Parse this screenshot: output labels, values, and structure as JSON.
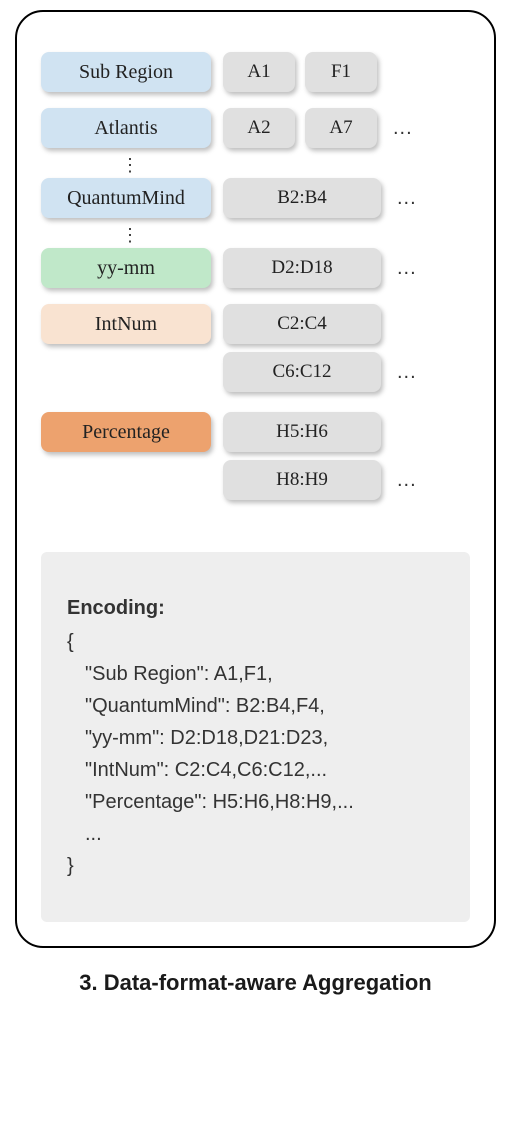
{
  "rows": {
    "sub_region": {
      "label": "Sub Region",
      "cells": [
        "A1",
        "F1"
      ]
    },
    "atlantis": {
      "label": "Atlantis",
      "cells": [
        "A2",
        "A7"
      ],
      "more": "..."
    },
    "quantummind": {
      "label": "QuantumMind",
      "cells": [
        "B2:B4"
      ],
      "more": "..."
    },
    "yymm": {
      "label": "yy-mm",
      "cells": [
        "D2:D18"
      ],
      "more": "..."
    },
    "intnum": {
      "label": "IntNum",
      "cells": [
        "C2:C4"
      ]
    },
    "intnum2": {
      "cells": [
        "C6:C12"
      ],
      "more": "..."
    },
    "percentage": {
      "label": "Percentage",
      "cells": [
        "H5:H6"
      ]
    },
    "percentage2": {
      "cells": [
        "H8:H9"
      ],
      "more": "..."
    }
  },
  "vdots": "⋮",
  "encoding": {
    "title": "Encoding:",
    "open": "{",
    "lines": [
      "\"Sub Region\": A1,F1,",
      "\"QuantumMind\": B2:B4,F4,",
      "\"yy-mm\": D2:D18,D21:D23,",
      "\"IntNum\": C2:C4,C6:C12,...",
      "\"Percentage\": H5:H6,H8:H9,...",
      "..."
    ],
    "close": "}"
  },
  "caption": "3. Data-format-aware Aggregation"
}
